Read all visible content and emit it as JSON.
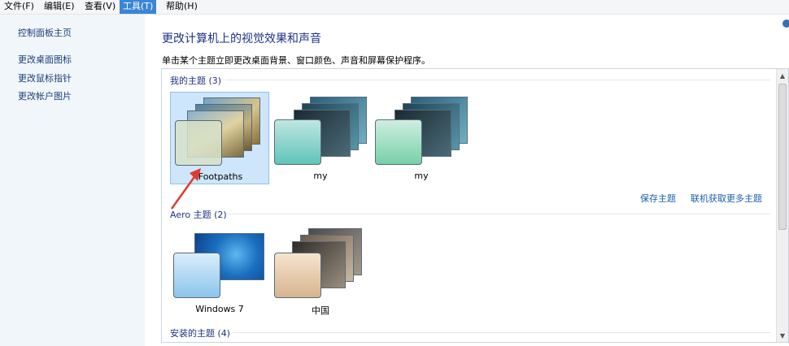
{
  "menu": {
    "items": [
      {
        "label": "文件(F)"
      },
      {
        "label": "编辑(E)"
      },
      {
        "label": "查看(V)"
      },
      {
        "label": "工具(T)"
      },
      {
        "label": "帮助(H)"
      }
    ],
    "active_index": 3
  },
  "sidebar": {
    "home": "控制面板主页",
    "links": [
      "更改桌面图标",
      "更改鼠标指针",
      "更改帐户图片"
    ]
  },
  "main": {
    "title": "更改计算机上的视觉效果和声音",
    "description": "单击某个主题立即更改桌面背景、窗口颜色、声音和屏幕保护程序。"
  },
  "groups": [
    {
      "header": "我的主题 (3)",
      "themes": [
        {
          "name": "Footpaths",
          "selected": true
        },
        {
          "name": "my"
        },
        {
          "name": "my"
        }
      ]
    },
    {
      "header": "Aero 主题 (2)",
      "themes": [
        {
          "name": "Windows 7"
        },
        {
          "name": "中国"
        }
      ]
    },
    {
      "header": "安装的主题 (4)",
      "themes": []
    }
  ],
  "actions": {
    "save": "保存主题",
    "more_online": "联机获取更多主题"
  },
  "colors": {
    "accent": "#3a86d6",
    "link": "#1a5fb4",
    "header": "#1e3287",
    "annotation_arrow": "#e03a2f"
  },
  "icons": [
    "help-icon",
    "scroll-up-icon",
    "scroll-down-icon"
  ]
}
